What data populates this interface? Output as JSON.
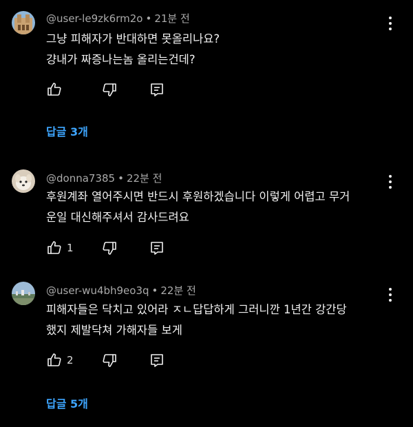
{
  "comments": [
    {
      "handle": "@user-le9zk6rm2o",
      "time": "21분 전",
      "lines": [
        "그냥 피해자가 반대하면 못올리나요?",
        "걍내가 짜증나는놈 올리는건데?"
      ],
      "likes": "",
      "replies": "답글 3개"
    },
    {
      "handle": "@donna7385",
      "time": "22분 전",
      "lines": [
        "후원계좌 열어주시면 반드시 후원하겠습니다 이렇게 어렵고 무거",
        "운일 대신해주셔서 감사드려요"
      ],
      "likes": "1",
      "replies": ""
    },
    {
      "handle": "@user-wu4bh9eo3q",
      "time": "22분 전",
      "lines": [
        "피해자들은 닥치고 있어라 ㅈㄴ답답하게 그러니깐 1년간 강간당",
        "했지 제발닥쳐 가해자들 보게"
      ],
      "likes": "2",
      "replies": "답글 5개"
    }
  ],
  "separator": "•",
  "colors": {
    "background": "#000000",
    "text": "#f1f1f1",
    "meta": "#aaaaaa",
    "link": "#3ea6ff"
  },
  "icons": [
    "like-icon",
    "dislike-icon",
    "reply-icon",
    "more-vert-icon"
  ]
}
